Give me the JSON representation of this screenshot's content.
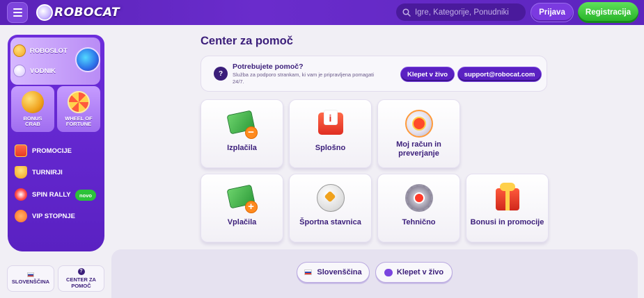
{
  "header": {
    "logo_text": "ROBOCAT",
    "search_placeholder": "Igre, Kategorije, Ponudniki",
    "login_label": "Prijava",
    "register_label": "Registracija"
  },
  "sidebar": {
    "top_items": [
      {
        "label": "ROBOSLOT",
        "icon": "coin-icon"
      },
      {
        "label": "VODNIK",
        "icon": "guide-icon"
      }
    ],
    "tiles": [
      {
        "label_line1": "BONUS",
        "label_line2": "CRAB",
        "icon": "bonus-crab-icon"
      },
      {
        "label_line1": "WHEEL OF",
        "label_line2": "FORTUNE",
        "icon": "wheel-of-fortune-icon"
      }
    ],
    "nav": [
      {
        "label": "PROMOCIJE",
        "icon": "gift-icon"
      },
      {
        "label": "TURNIRJI",
        "icon": "trophy-icon"
      },
      {
        "label": "SPIN RALLY",
        "icon": "spin-rally-icon",
        "badge": "novo"
      },
      {
        "label": "VIP STOPNJE",
        "icon": "vip-icon"
      }
    ],
    "language_label": "SLOVENŠČINA",
    "help_line1": "CENTER ZA",
    "help_line2": "POMOČ"
  },
  "main": {
    "title": "Center za pomoč",
    "help_box": {
      "title": "Potrebujete pomoč?",
      "description": "Služba za podporo strankam, ki vam je pripravljena pomagati 24/7.",
      "chat_label": "Klepet v živo",
      "email_label": "support@robocat.com"
    },
    "categories": [
      {
        "label": "Izplačila",
        "icon": "withdrawal-cash-icon"
      },
      {
        "label": "Splošno",
        "icon": "info-envelope-icon"
      },
      {
        "label": "Moj račun in preverjanje",
        "icon": "account-icon"
      },
      {
        "label": "Vplačila",
        "icon": "deposit-cash-icon"
      },
      {
        "label": "Športna stavnica",
        "icon": "football-icon"
      },
      {
        "label": "Tehnično",
        "icon": "gear-icon"
      },
      {
        "label": "Bonusi in promocije",
        "icon": "gift-box-icon"
      }
    ]
  },
  "footer": {
    "language_label": "Slovenščina",
    "chat_label": "Klepet v živo"
  },
  "colors": {
    "header": "#5a22b8",
    "accent": "#5a21c2",
    "register": "#24b025",
    "text": "#3b1e7a"
  }
}
